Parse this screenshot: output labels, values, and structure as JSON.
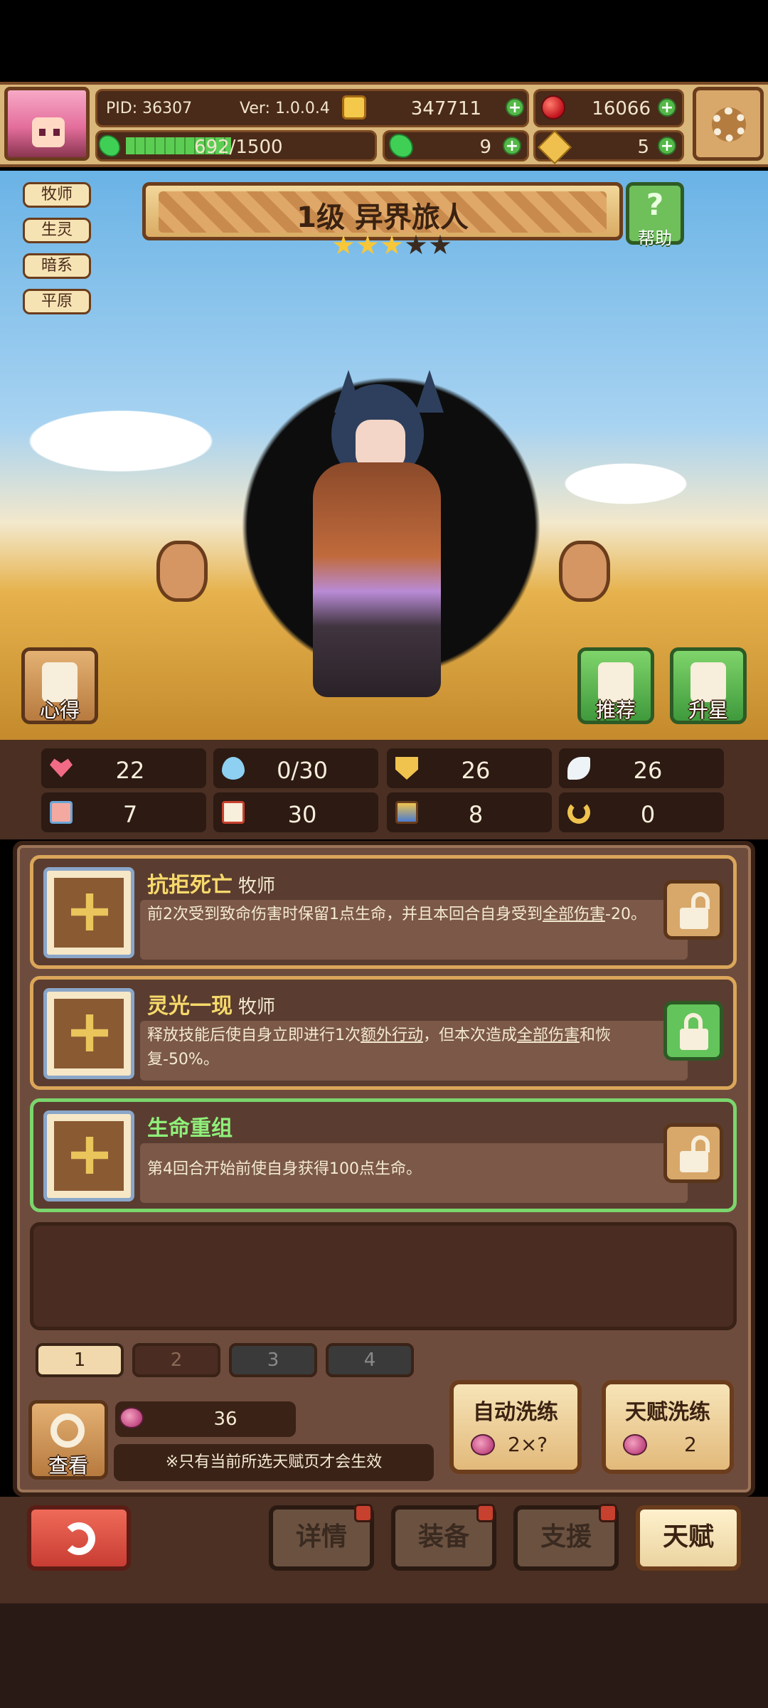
{
  "header": {
    "pid": "PID: 36307",
    "version": "Ver: 1.0.0.4",
    "gold": "347711",
    "gems": "16066",
    "exp": "692/1500",
    "exp_progress": 0.4613,
    "clover": "9",
    "keys": "5"
  },
  "tags": [
    "牧师",
    "生灵",
    "暗系",
    "平原"
  ],
  "hero": {
    "title": "1级  异界旅人",
    "stars_filled": 3,
    "stars_total": 5,
    "help_label": "帮助"
  },
  "side_buttons": {
    "insight": "心得",
    "recommend": "推荐",
    "upgrade_star": "升星"
  },
  "stats": [
    {
      "icon": "heart-icon",
      "value": "22"
    },
    {
      "icon": "drop-icon",
      "value": "0/30"
    },
    {
      "icon": "shield-icon",
      "value": "26"
    },
    {
      "icon": "wing-icon",
      "value": "26"
    },
    {
      "icon": "fist-icon",
      "value": "7"
    },
    {
      "icon": "book-icon",
      "value": "30"
    },
    {
      "icon": "scroll-icon",
      "value": "8"
    },
    {
      "icon": "horseshoe-icon",
      "value": "0"
    }
  ],
  "talents": [
    {
      "name": "抗拒死亡",
      "class": "牧师",
      "desc_parts": [
        "前2次受到致命伤害时保留1点生命，并且本回合自身受到",
        "全部伤害",
        "-20。"
      ],
      "locked": false
    },
    {
      "name": "灵光一现",
      "class": "牧师",
      "desc_parts": [
        "释放技能后使自身立即进行1次",
        "额外行动",
        "，但本次造成",
        "全部伤害",
        "和恢复-50%。"
      ],
      "locked": true
    },
    {
      "name": "生命重组",
      "class": "",
      "desc_parts": [
        "第4回合开始前使自身获得100点生命。"
      ],
      "locked": false
    }
  ],
  "pages": [
    "1",
    "2",
    "3",
    "4"
  ],
  "active_page": "1",
  "bottom_panel": {
    "view_label": "查看",
    "resource_count": "36",
    "note": "※只有当前所选天赋页才会生效",
    "auto_wash": {
      "title": "自动洗练",
      "cost": "2×?"
    },
    "talent_wash": {
      "title": "天赋洗练",
      "cost": "2"
    }
  },
  "nav": {
    "details": "详情",
    "equip": "装备",
    "support": "支援",
    "talent": "天赋"
  },
  "colors": {
    "gold_text": "#f7d96b",
    "green_text": "#8ff07a",
    "panel_bg": "#6e4c3d",
    "back_red": "#ef6a58"
  }
}
